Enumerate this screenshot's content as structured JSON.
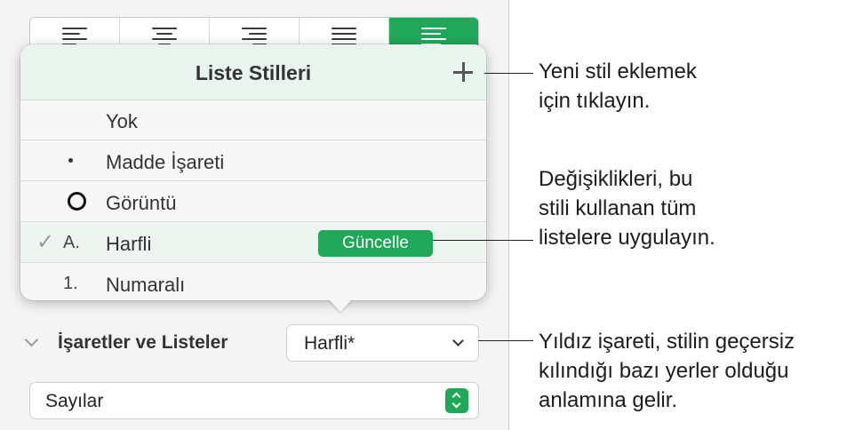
{
  "popover": {
    "title": "Liste Stilleri",
    "items": [
      {
        "label": "Yok",
        "prefix": ""
      },
      {
        "label": "Madde İşareti",
        "prefix": "•"
      },
      {
        "label": "Görüntü",
        "prefix": "image"
      },
      {
        "label": "Harfli",
        "prefix": "A.",
        "selected": true
      },
      {
        "label": "Numaralı",
        "prefix": "1."
      }
    ],
    "update_label": "Güncelle"
  },
  "section": {
    "title": "İşaretler ve Listeler",
    "style_value": "Harfli*",
    "type_value": "Sayılar"
  },
  "callouts": {
    "add": [
      "Yeni stil eklemek",
      "için tıklayın."
    ],
    "update": [
      "Değişiklikleri, bu",
      "stili kullanan tüm",
      "listelere uygulayın."
    ],
    "asterisk": [
      "Yıldız işareti, stilin geçersiz",
      "kılındığı bazı yerler olduğu",
      "anlamına gelir."
    ]
  },
  "colors": {
    "accent": "#1fa85a"
  }
}
